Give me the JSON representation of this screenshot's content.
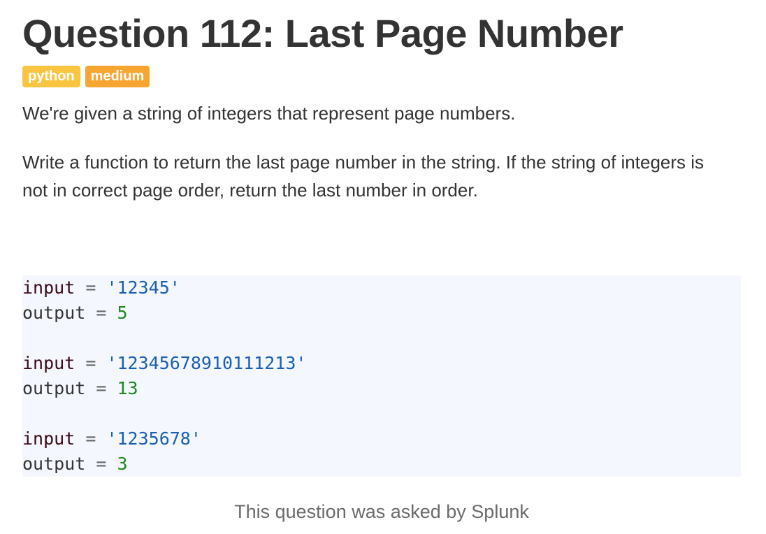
{
  "question": {
    "title": "Question 112: Last Page Number",
    "tags": [
      "python",
      "medium"
    ],
    "description": [
      "We're given a string of integers that represent page numbers.",
      "Write a function to return the last page number in the string. If the string of integers is not in correct page order, return the last number in order."
    ],
    "examples": [
      {
        "input_var": "input",
        "input_value": "'12345'",
        "output_var": "output",
        "output_value": "5"
      },
      {
        "input_var": "input",
        "input_value": "'12345678910111213'",
        "output_var": "output",
        "output_value": "13"
      },
      {
        "input_var": "input",
        "input_value": "'1235678'",
        "output_var": "output",
        "output_value": "3"
      }
    ],
    "operator": "=",
    "asked_by": "This question was asked by Splunk"
  },
  "colors": {
    "tag_language": "#f9c440",
    "tag_difficulty": "#f7a531",
    "code_background": "#f4f7fd",
    "string_literal": "#1a5fb4",
    "number_literal": "#1f8a1f"
  }
}
